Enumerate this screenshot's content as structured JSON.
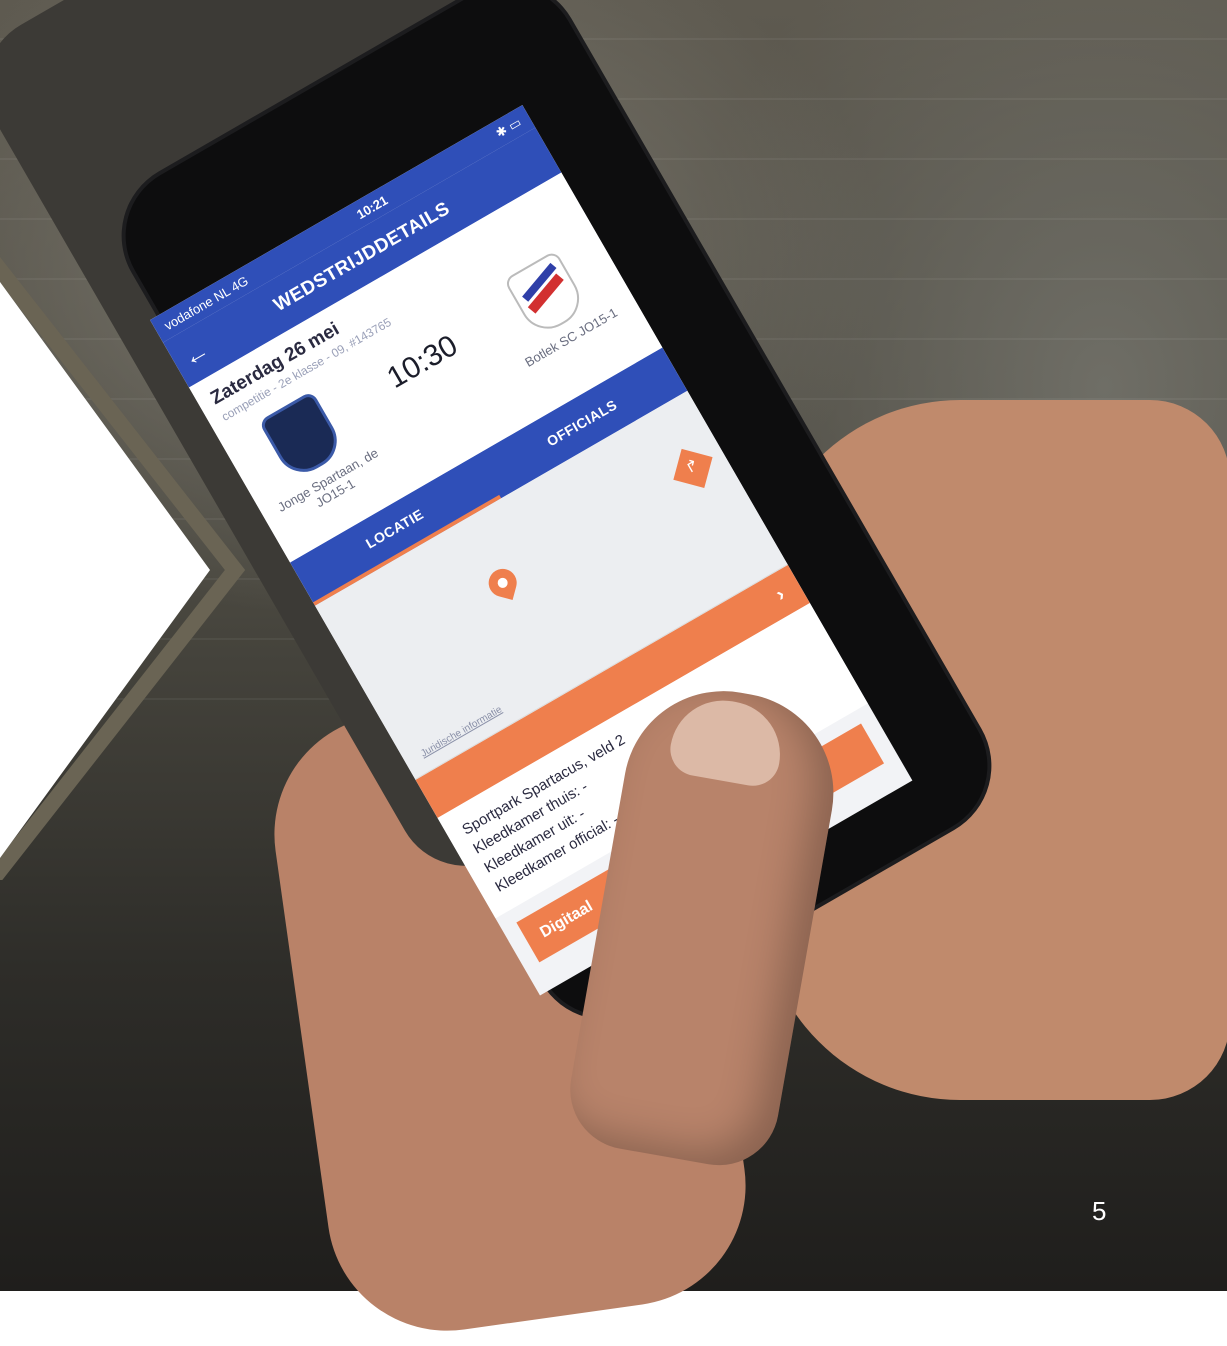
{
  "status_bar": {
    "carrier": "vodafone NL 4G",
    "time": "10:21",
    "icons": [
      "bluetooth-icon",
      "battery-icon"
    ]
  },
  "app_bar": {
    "back_icon": "arrow-left-icon",
    "title": "WEDSTRIJDDETAILS"
  },
  "match": {
    "date": "Zaterdag 26 mei",
    "meta": "competitie - 2e klasse - 09, #143765",
    "kickoff": "10:30",
    "home_team": "Jonge Spartaan, de JO15-1",
    "away_team": "Botlek SC JO15-1"
  },
  "tabs": [
    {
      "label": "LOCATIE",
      "active": true
    },
    {
      "label": "OFFICIALS",
      "active": false
    }
  ],
  "map": {
    "legal_link": "Juridische informatie",
    "pin_icon": "map-pin-icon",
    "directions_icon": "directions-icon"
  },
  "route_bar": {
    "chevron": "›"
  },
  "venue": {
    "name": "Sportpark Spartacus, veld 2",
    "home_dressing": "Kleedkamer thuis: -",
    "away_dressing": "Kleedkamer uit: -",
    "official_dressing": "Kleedkamer official: -"
  },
  "digital_button": {
    "label": "Digitaal"
  },
  "slide": {
    "page_number": "5"
  },
  "colors": {
    "brand_blue": "#2f4fb8",
    "accent_orange": "#ef7f4d"
  }
}
